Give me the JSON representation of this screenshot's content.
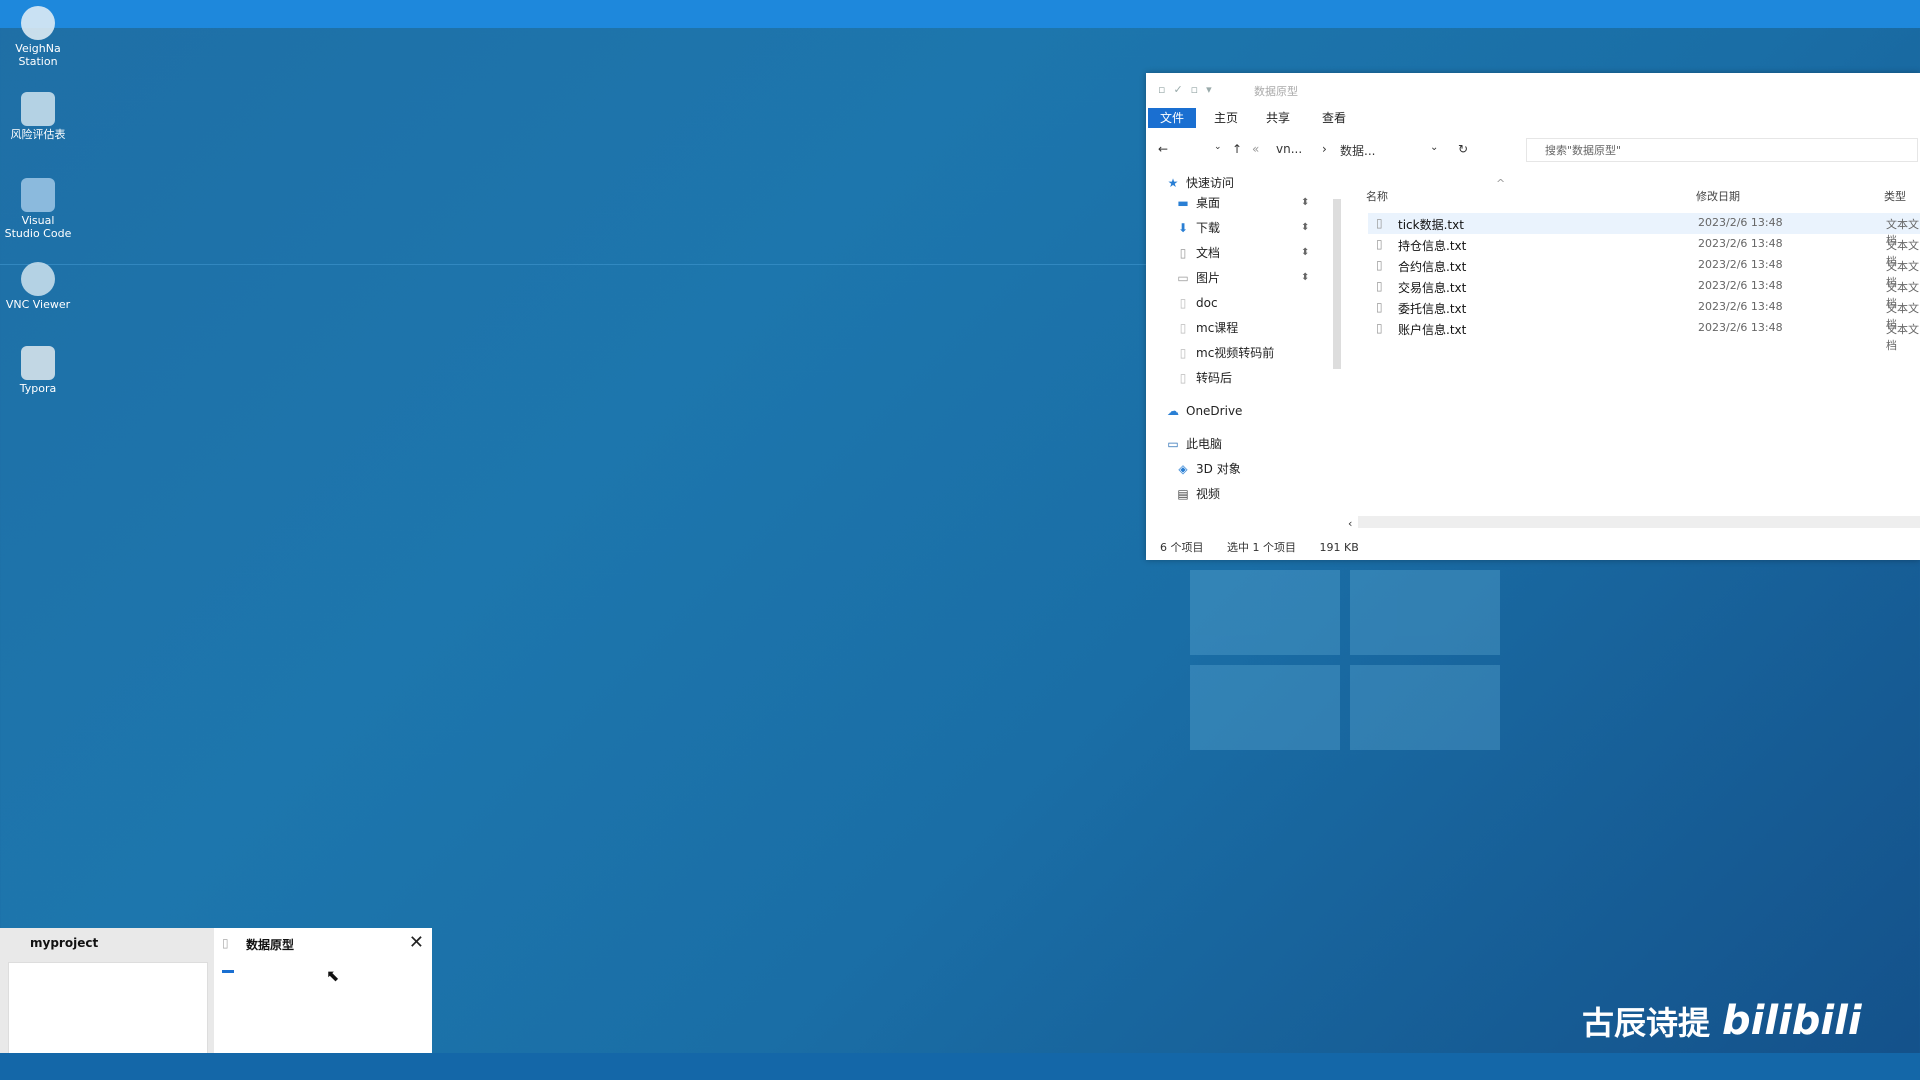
{
  "desktop": {
    "icons": [
      {
        "label": "VeighNa Station",
        "icon": "veighna-icon"
      },
      {
        "label": "风险评估表",
        "icon": "document-icon"
      },
      {
        "label": "Visual Studio Code",
        "icon": "vscode-icon"
      },
      {
        "label": "VNC Viewer",
        "icon": "vnc-icon"
      },
      {
        "label": "Typora",
        "icon": "typora-icon"
      }
    ]
  },
  "explorer": {
    "title": "数据原型",
    "ribbon_tabs": [
      "文件",
      "主页",
      "共享",
      "查看"
    ],
    "breadcrumb": [
      "vn...",
      "数据..."
    ],
    "search_placeholder": "搜索\"数据原型\"",
    "nav_items": [
      {
        "label": "快速访问",
        "icon": "star-icon"
      },
      {
        "label": "桌面",
        "icon": "desktop-folder-icon",
        "pinned": true
      },
      {
        "label": "下载",
        "icon": "download-icon",
        "pinned": true
      },
      {
        "label": "文档",
        "icon": "documents-icon",
        "pinned": true
      },
      {
        "label": "图片",
        "icon": "pictures-icon",
        "pinned": true
      },
      {
        "label": "doc",
        "icon": "folder-icon"
      },
      {
        "label": "mc课程",
        "icon": "folder-icon"
      },
      {
        "label": "mc视频转码前",
        "icon": "folder-icon"
      },
      {
        "label": "转码后",
        "icon": "folder-icon"
      },
      {
        "label": "OneDrive",
        "icon": "onedrive-icon"
      },
      {
        "label": "此电脑",
        "icon": "computer-icon"
      },
      {
        "label": "3D 对象",
        "icon": "3d-objects-icon"
      },
      {
        "label": "视频",
        "icon": "video-icon"
      }
    ],
    "columns": [
      "名称",
      "修改日期",
      "类型"
    ],
    "files": [
      {
        "name": "tick数据.txt",
        "date": "2023/2/6 13:48",
        "type": "文本文档",
        "selected": true
      },
      {
        "name": "持仓信息.txt",
        "date": "2023/2/6 13:48",
        "type": "文本文档"
      },
      {
        "name": "合约信息.txt",
        "date": "2023/2/6 13:48",
        "type": "文本文档"
      },
      {
        "name": "交易信息.txt",
        "date": "2023/2/6 13:48",
        "type": "文本文档"
      },
      {
        "name": "委托信息.txt",
        "date": "2023/2/6 13:48",
        "type": "文本文档"
      },
      {
        "name": "账户信息.txt",
        "date": "2023/2/6 13:48",
        "type": "文本文档"
      }
    ],
    "status": {
      "count": "6 个项目",
      "selection": "选中 1 个项目",
      "size": "191 KB"
    }
  },
  "taskbar_preview": {
    "left_title": "myproject",
    "right_title": "数据原型",
    "close_label": "✕"
  },
  "watermark": {
    "author": "古辰诗提",
    "brand": "bilibili"
  }
}
